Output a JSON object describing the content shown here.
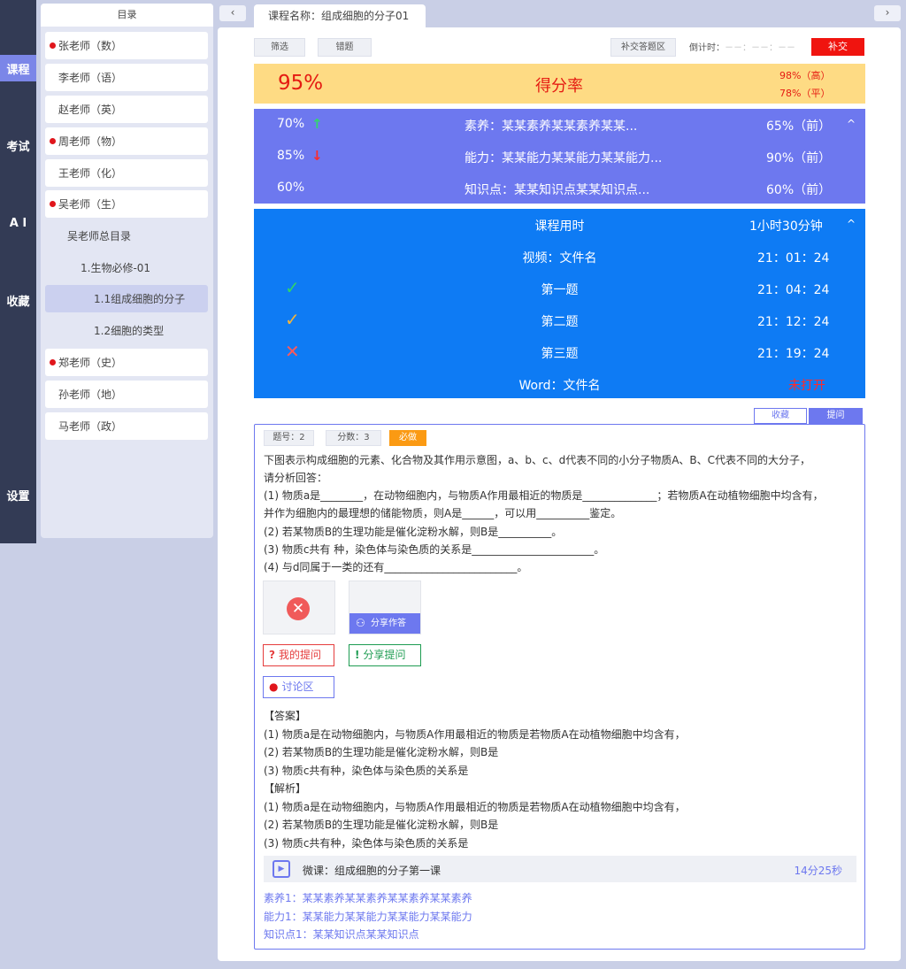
{
  "rail": [
    "课程",
    "考试",
    "A I",
    "收藏",
    "设置"
  ],
  "directory": {
    "title": "目录",
    "teachers_top": [
      {
        "name": "张老师（数）",
        "dot": true
      },
      {
        "name": "李老师（语）",
        "dot": false
      },
      {
        "name": "赵老师（英）",
        "dot": false
      },
      {
        "name": "周老师（物）",
        "dot": true
      },
      {
        "name": "王老师（化）",
        "dot": false
      },
      {
        "name": "吴老师（生）",
        "dot": true
      }
    ],
    "sub": [
      "吴老师总目录",
      "1.生物必修-01",
      "1.1组成细胞的分子",
      "1.2细胞的类型"
    ],
    "teachers_bottom": [
      {
        "name": "郑老师（史）",
        "dot": true
      },
      {
        "name": "孙老师（地）",
        "dot": false
      },
      {
        "name": "马老师（政）",
        "dot": false
      }
    ]
  },
  "nav": {
    "prev": "‹",
    "next": "›",
    "tab": "课程名称：组成细胞的分子01"
  },
  "toolbar": {
    "filter": "筛选",
    "wrong": "错题",
    "makeup_area": "补交答题区",
    "countdown_label": "倒计时：",
    "countdown_value": "－－：－－：－－",
    "submit": "补交"
  },
  "score": {
    "pct": "95%",
    "label": "得分率",
    "high": "98%（高）",
    "avg": "78%（平）",
    "bg": "#fedb84"
  },
  "ability_rows": [
    {
      "value": "70%",
      "arrow": "↑",
      "trend": "up",
      "name": "素养：某某素养某某素养某某...",
      "rank": "65%（前）"
    },
    {
      "value": "85%",
      "arrow": "↓",
      "trend": "down",
      "name": "能力：某某能力某某能力某某能力...",
      "rank": "90%（前）"
    },
    {
      "value": "60%",
      "arrow": "",
      "trend": "",
      "name": "知识点：某某知识点某某知识点...",
      "rank": "60%（前）"
    }
  ],
  "caret_up": "^",
  "course_time": {
    "title": "课程用时",
    "total": "1小时30分钟",
    "rows": [
      {
        "mark": "",
        "name": "视频：文件名",
        "time": "21：01：24"
      },
      {
        "mark": "✓",
        "mark_color": "#2fd36a",
        "name": "第一题",
        "time": "21：04：24"
      },
      {
        "mark": "✓",
        "mark_color": "#f4b43a",
        "name": "第二题",
        "time": "21：12：24"
      },
      {
        "mark": "✕",
        "mark_color": "#ff5a5a",
        "name": "第三题",
        "time": "21：19：24"
      },
      {
        "mark": "",
        "name": "Word：文件名",
        "time": "未打开",
        "time_color": "#ff2a2a"
      }
    ]
  },
  "question_tabs": {
    "fav": "收藏",
    "ask": "提问"
  },
  "question": {
    "number": "题号：2",
    "score": "分数：3",
    "must": "必做",
    "lines": [
      "下图表示构成细胞的元素、化合物及其作用示意图，a、b、c、d代表不同的小分子物质A、B、C代表不同的大分子，",
      "请分析回答：",
      "(1) 物质a是________，在动物细胞内，与物质A作用最相近的物质是______________；若物质A在动植物细胞中均含有，",
      "并作为细胞内的最理想的储能物质，则A是______，可以用__________鉴定。",
      "(2) 若某物质B的生理功能是催化淀粉水解，则B是__________。",
      "(3) 物质c共有          种，染色体与染色质的关系是_______________________。",
      "(4) 与d同属于一类的还有_________________________。"
    ],
    "share_answer": "分享作答",
    "my_question": "我的提问",
    "share_question": "分享提问",
    "discussion": "讨论区",
    "answer_lines": [
      "【答案】",
      "(1) 物质a是在动物细胞内，与物质A作用最相近的物质是若物质A在动植物细胞中均含有，",
      "(2) 若某物质B的生理功能是催化淀粉水解，则B是",
      "(3) 物质c共有种，染色体与染色质的关系是",
      "【解析】",
      "(1) 物质a是在动物细胞内，与物质A作用最相近的物质是若物质A在动植物细胞中均含有，",
      "(2) 若某物质B的生理功能是催化淀粉水解，则B是",
      "(3) 物质c共有种，染色体与染色质的关系是"
    ],
    "micro": {
      "title": "微课：组成细胞的分子第一课",
      "duration": "14分25秒"
    },
    "tags": [
      "素养1：某某素养某某素养某某素养某某素养",
      "能力1：某某能力某某能力某某能力某某能力",
      "知识点1：某某知识点某某知识点"
    ]
  },
  "colors": {
    "accent": "#6d78ef",
    "blue": "#0e7bf4",
    "red": "#e51b12",
    "orange": "#fb9a13",
    "rail": "#333b55"
  }
}
